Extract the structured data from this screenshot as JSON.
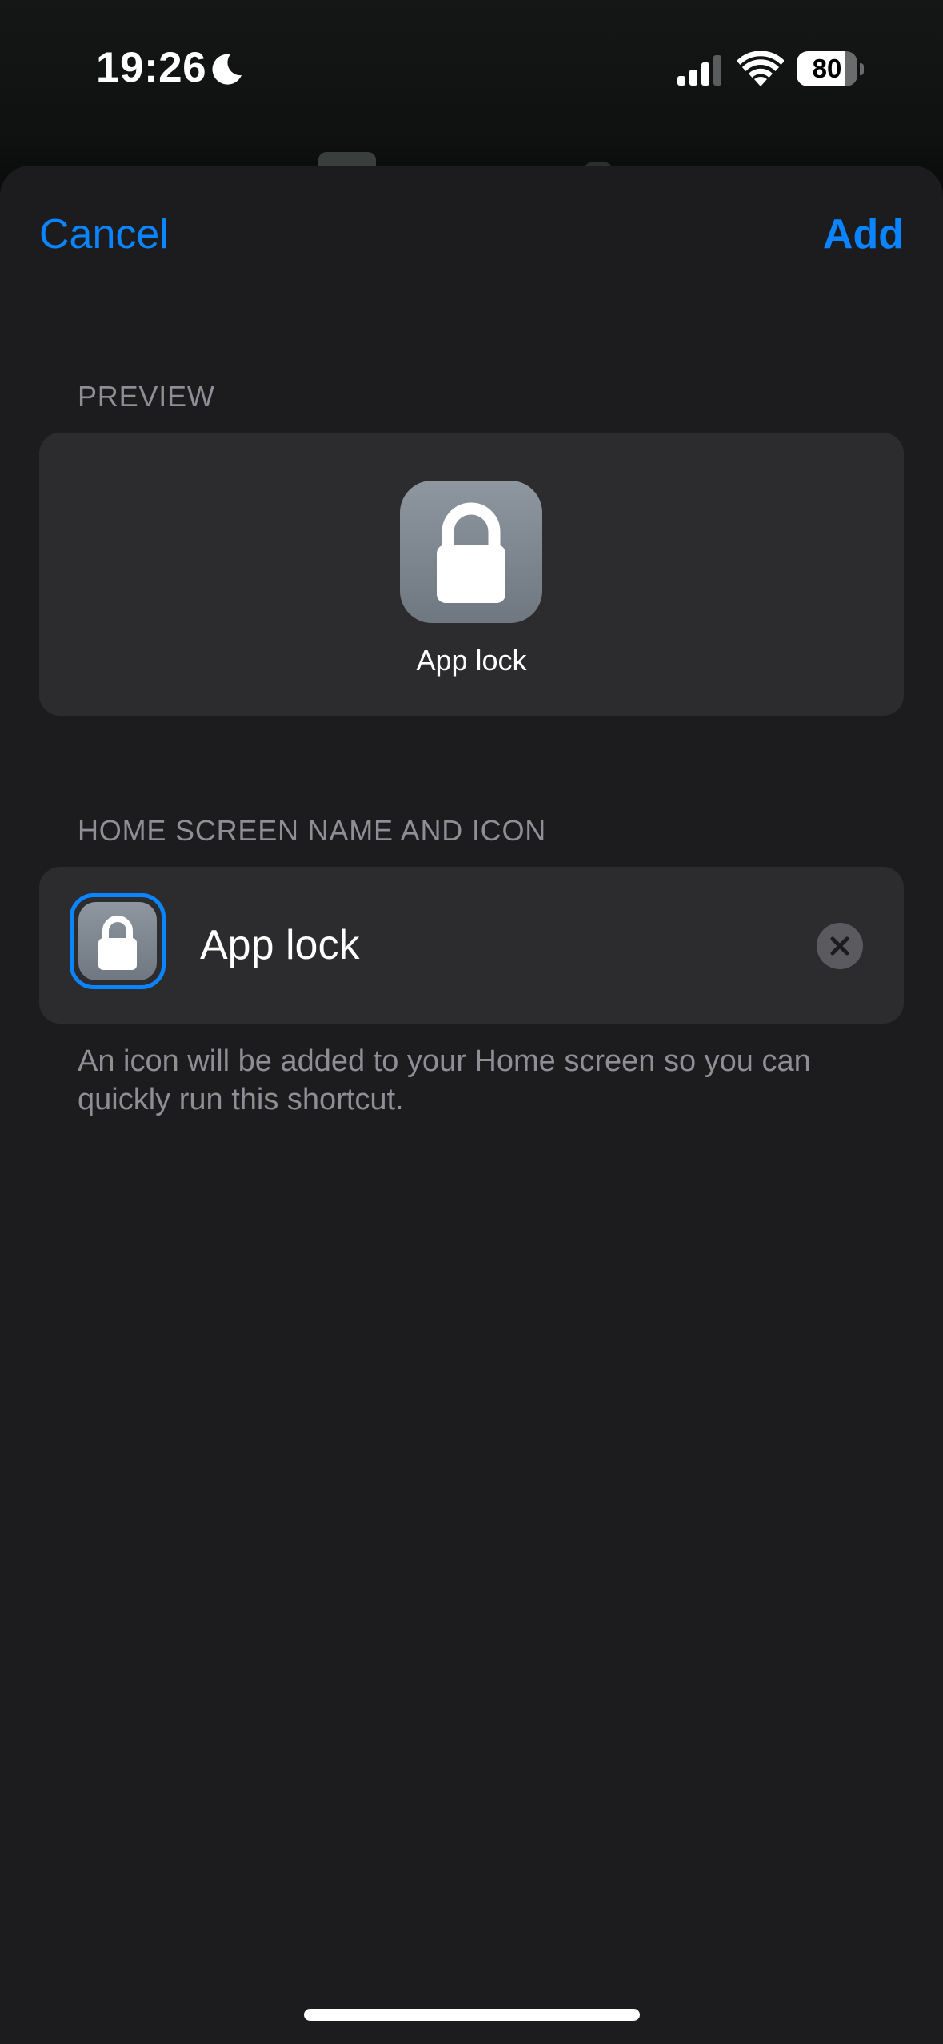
{
  "status_bar": {
    "time": "19:26",
    "battery_level": "80",
    "battery_fraction": 0.8,
    "icons": [
      "moon-icon",
      "cellular-signal-icon",
      "wifi-icon",
      "battery-icon"
    ]
  },
  "navigation": {
    "cancel_label": "Cancel",
    "add_label": "Add",
    "accent_color": "#0a84ff"
  },
  "preview_section": {
    "header": "PREVIEW",
    "icon": "lock-icon",
    "label": "App lock"
  },
  "home_screen_section": {
    "header": "HOME SCREEN NAME AND ICON",
    "icon": "lock-icon",
    "name_value": "App lock",
    "clear_icon": "clear-x-icon",
    "footer": "An icon will be added to your Home screen so you can quickly run this shortcut."
  },
  "colors": {
    "sheet_background": "#1c1c1e",
    "card_background": "#2c2c2e",
    "secondary_text": "#8e8e93",
    "icon_gradient_top": "#8e969f",
    "icon_gradient_bottom": "#6f7780"
  }
}
